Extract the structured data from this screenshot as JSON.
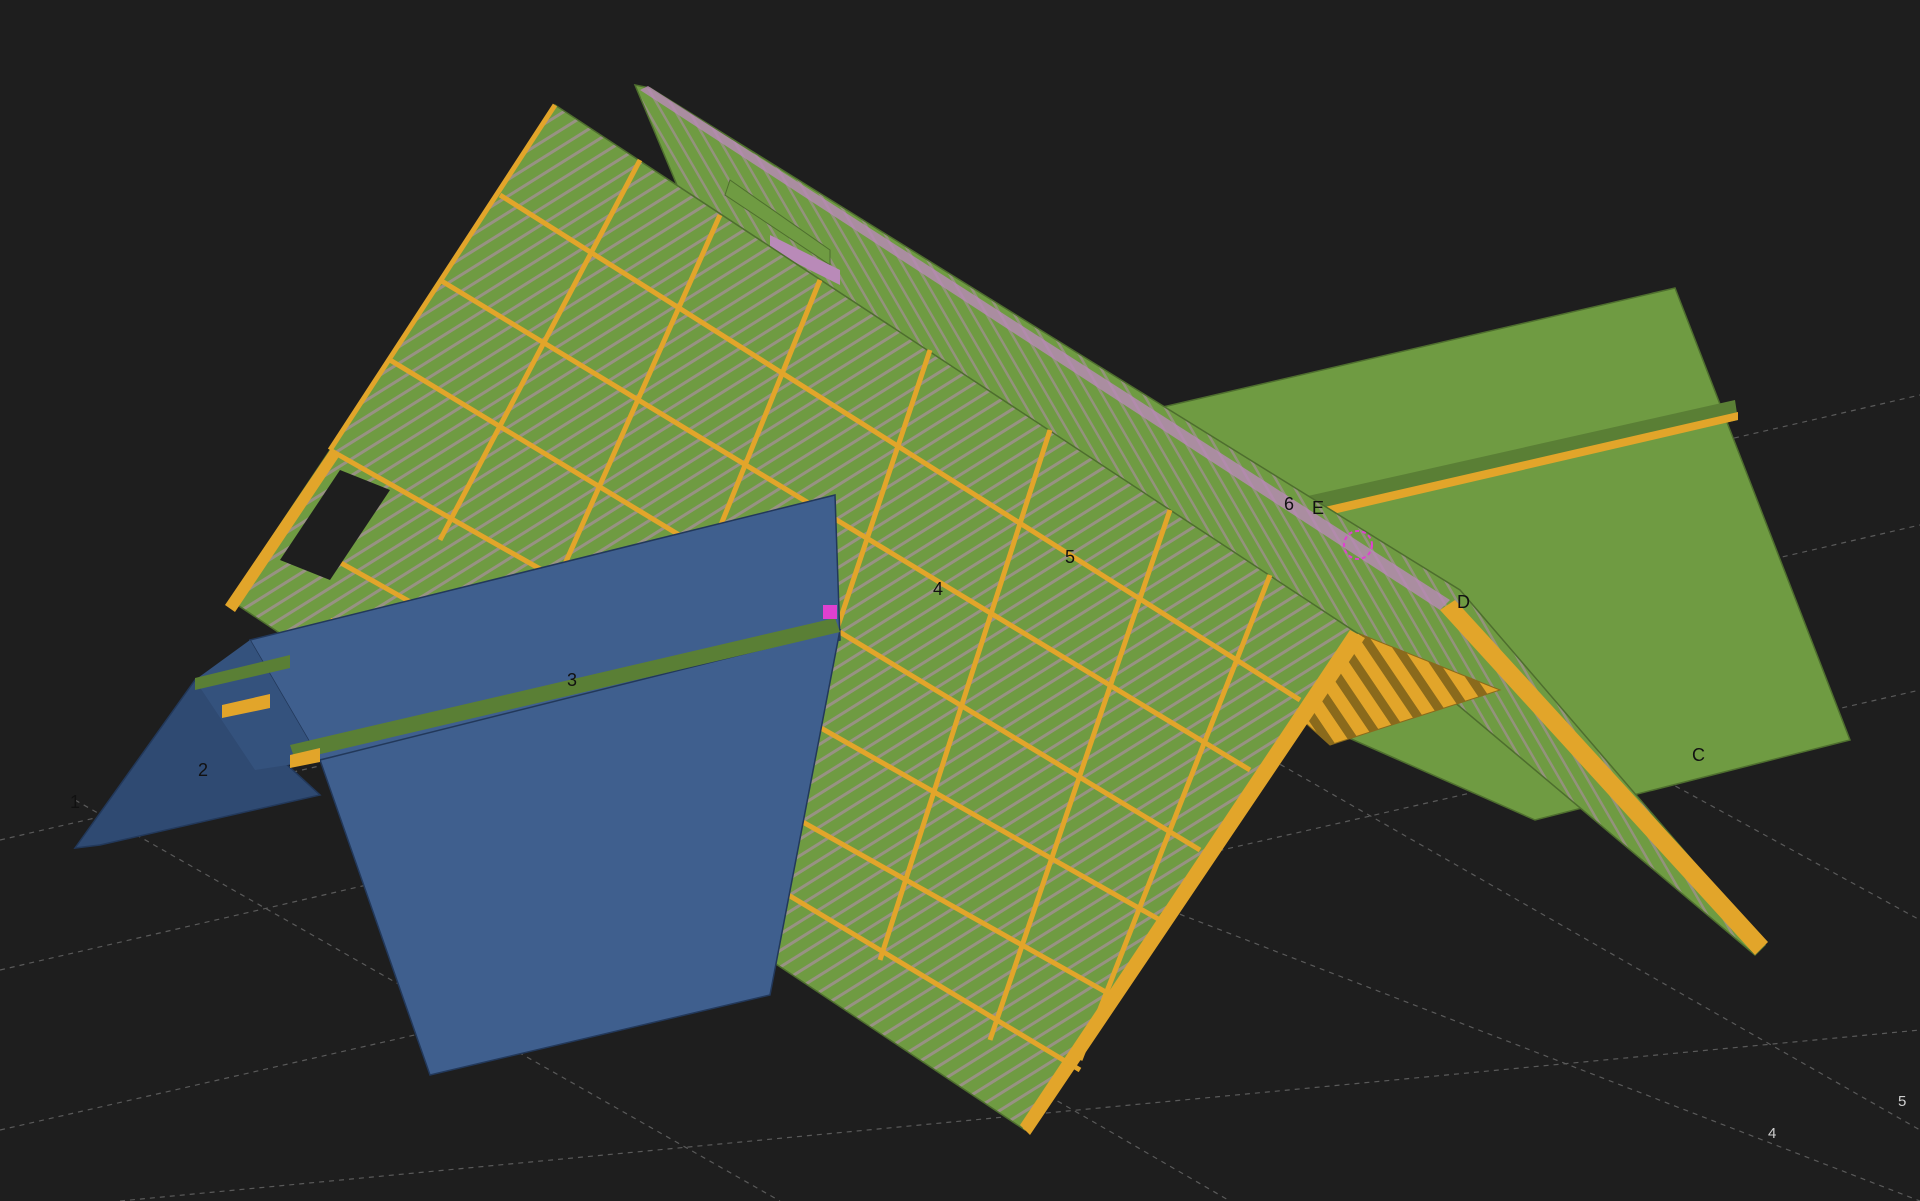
{
  "viewport": {
    "background": "#1e1e1e",
    "colors": {
      "roof_green": "#6f9b42",
      "roof_green_dark": "#5a7f35",
      "timber_orange": "#e2a52a",
      "roof_blue": "#3f5f8e",
      "roof_blue_dark": "#2f4a72",
      "batten_purple": "#b98ab8",
      "grid_line": "#555555",
      "selection_magenta": "#e040d0"
    }
  },
  "axis_labels": {
    "axis_1": "1",
    "axis_2": "2",
    "axis_3": "3",
    "axis_4": "4",
    "axis_5": "5",
    "axis_6": "6",
    "axis_c": "C",
    "axis_d": "D",
    "axis_e": "E"
  },
  "grid_labels": {
    "grid_4": "4",
    "grid_5": "5"
  },
  "icons": {
    "selection_marker": "selection-circle-icon"
  }
}
